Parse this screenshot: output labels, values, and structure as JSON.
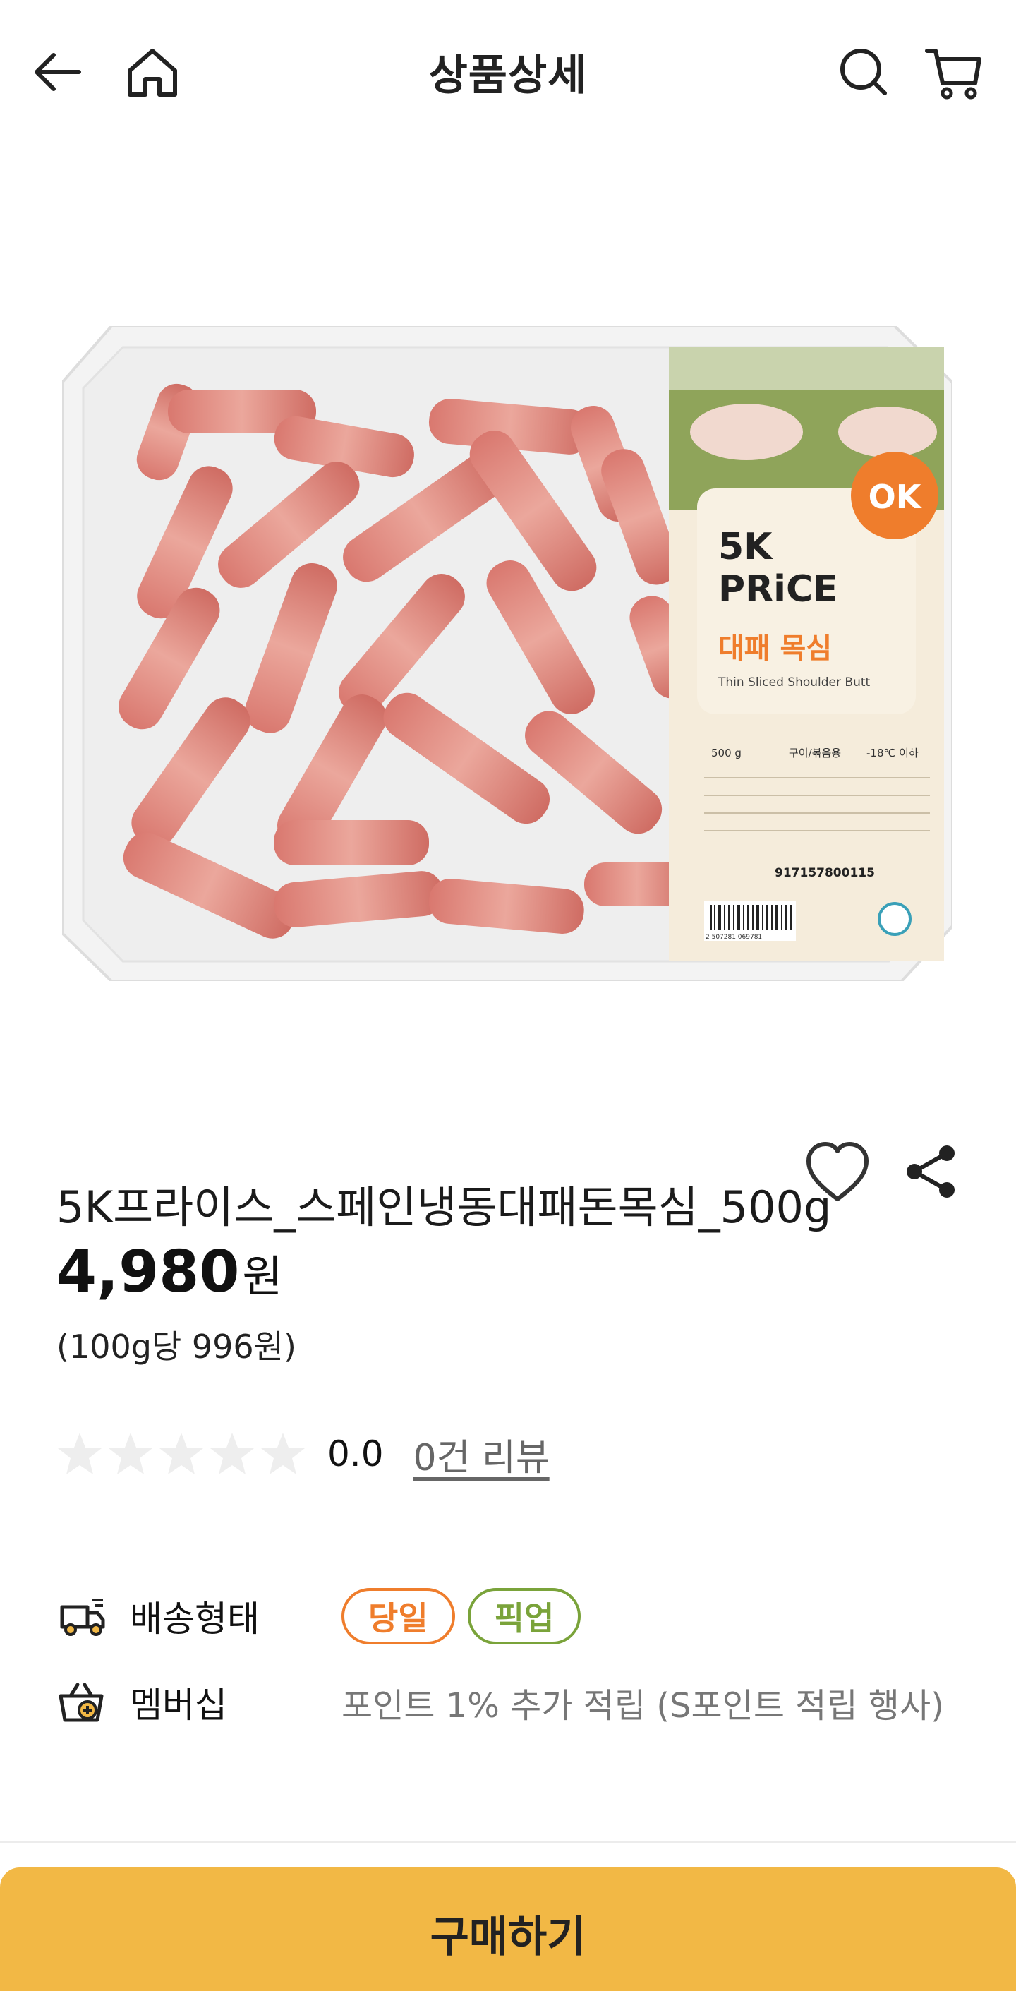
{
  "header": {
    "title": "상품상세",
    "back_icon": "arrow-left-icon",
    "home_icon": "home-icon",
    "search_icon": "search-icon",
    "cart_icon": "cart-icon"
  },
  "product_image": {
    "brand_line1": "5K",
    "brand_line2": "PRiCE",
    "product_name_ko": "대패 목심",
    "product_name_en": "Thin Sliced Shoulder Butt",
    "logo_text": "OK",
    "weight": "500 g",
    "usage": "구이/볶음용",
    "storage": "-18℃ 이하",
    "trace_no": "917157800115",
    "barcode": "2 507281 069781"
  },
  "product": {
    "title": "5K프라이스_스페인냉동대패돈목심_500g",
    "price": "4,980",
    "price_unit": "원",
    "unit_price": "(100g당 996원)"
  },
  "rating": {
    "score": "0.0",
    "review_link": "0건 리뷰",
    "stars_filled": 0,
    "stars_total": 5
  },
  "delivery": {
    "label": "배송형태",
    "badges": [
      "당일",
      "픽업"
    ]
  },
  "membership": {
    "label": "멤버십",
    "text": "포인트 1% 추가 적립 (S포인트 적립 행사)"
  },
  "buy_button": "구매하기",
  "colors": {
    "accent": "#f2b845",
    "badge_orange": "#ef7d2c",
    "badge_green": "#7aa33a",
    "star_empty": "#eeeeee"
  }
}
